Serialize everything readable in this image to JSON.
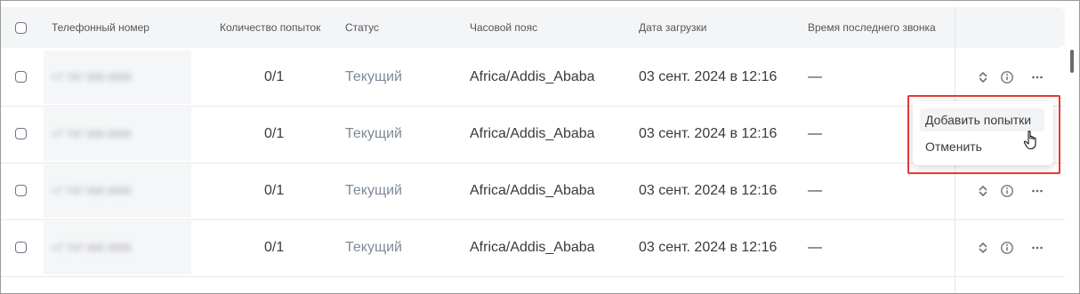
{
  "table": {
    "headers": {
      "phone": "Телефонный номер",
      "attempts": "Количество попыток",
      "status": "Статус",
      "timezone": "Часовой пояс",
      "upload_date": "Дата загрузки",
      "last_call": "Время последнего звонка"
    },
    "rows": [
      {
        "phone": "+7 747 000 0000",
        "attempts": "0/1",
        "status": "Текущий",
        "timezone": "Africa/Addis_Ababa",
        "upload_date": "03 сент. 2024 в 12:16",
        "last_call": "—"
      },
      {
        "phone": "+7 747 000 0000",
        "attempts": "0/1",
        "status": "Текущий",
        "timezone": "Africa/Addis_Ababa",
        "upload_date": "03 сент. 2024 в 12:16",
        "last_call": "—"
      },
      {
        "phone": "+7 747 000 0000",
        "attempts": "0/1",
        "status": "Текущий",
        "timezone": "Africa/Addis_Ababa",
        "upload_date": "03 сент. 2024 в 12:16",
        "last_call": "—"
      },
      {
        "phone": "+7 747 000 0000",
        "attempts": "0/1",
        "status": "Текущий",
        "timezone": "Africa/Addis_Ababa",
        "upload_date": "03 сент. 2024 в 12:16",
        "last_call": "—"
      }
    ],
    "row_actions": [
      "sort-arrows-icon",
      "info-icon",
      "more-icon"
    ]
  },
  "context_menu": {
    "items": [
      "Добавить попытки",
      "Отменить"
    ]
  },
  "colors": {
    "header_bg": "#f4f5f7",
    "status_text": "#7e8a98",
    "highlight": "#e53935"
  }
}
